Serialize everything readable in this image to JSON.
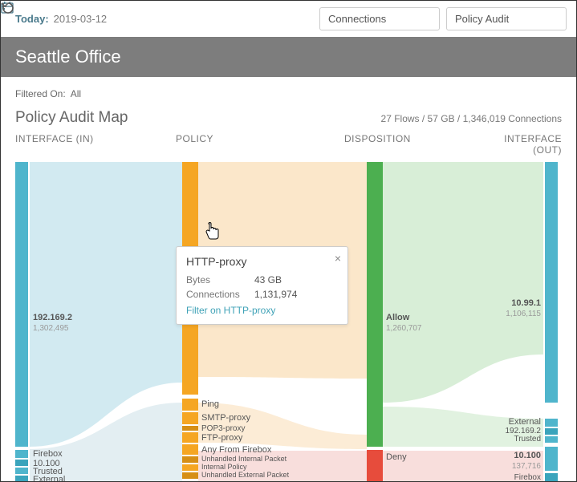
{
  "topbar": {
    "date_label": "Today:",
    "date_value": "2019-03-12",
    "dropdown_data": "Connections",
    "dropdown_view": "Policy Audit"
  },
  "page_title": "Seattle Office",
  "filter": {
    "label": "Filtered On:",
    "value": "All"
  },
  "map": {
    "title": "Policy Audit Map",
    "stats": "27 Flows / 57 GB / 1,346,019 Connections"
  },
  "columns": [
    "INTERFACE (IN)",
    "POLICY",
    "DISPOSITION",
    "INTERFACE (OUT)"
  ],
  "tooltip": {
    "title": "HTTP-proxy",
    "bytes_label": "Bytes",
    "bytes_value": "43 GB",
    "conn_label": "Connections",
    "conn_value": "1,131,974",
    "filter_link": "Filter on HTTP-proxy"
  },
  "labels": {
    "in_main": "192.169.2",
    "in_main_v": "1,302,495",
    "in_firebox": "Firebox",
    "in_10100": "10.100",
    "in_trusted": "Trusted",
    "in_external": "External",
    "pol_ping": "Ping",
    "pol_smtp": "SMTP-proxy",
    "pol_pop3": "POP3-proxy",
    "pol_ftp": "FTP-proxy",
    "pol_any": "Any From Firebox",
    "pol_unh_int": "Unhandled Internal Packet",
    "pol_intpol": "Internal Policy",
    "pol_unh_ext": "Unhandled External Packet",
    "disp_allow": "Allow",
    "disp_allow_v": "1,260,707",
    "disp_deny": "Deny",
    "out_1099": "10.99.1",
    "out_1099_v": "1,106,115",
    "out_external": "External",
    "out_19216": "192.169.2",
    "out_trusted": "Trusted",
    "out_10100": "10.100",
    "out_10100_v": "137,716",
    "out_firebox": "Firebox"
  },
  "colors": {
    "interface_in": "#4fb5cc",
    "policy": "#f5a623",
    "disposition_allow": "#4caf50",
    "disposition_deny": "#e74c3c",
    "interface_out": "#4fb5cc",
    "flow_blue": "#cde8ef",
    "flow_orange": "#fbe4c4",
    "flow_green": "#d4ecd3",
    "flow_pink": "#f6d6d3"
  },
  "chart_data": {
    "type": "sankey",
    "title": "Policy Audit Map",
    "totals": {
      "flows": 27,
      "bytes_gb": 57,
      "connections": 1346019
    },
    "stages": [
      "INTERFACE (IN)",
      "POLICY",
      "DISPOSITION",
      "INTERFACE (OUT)"
    ],
    "nodes": {
      "interface_in": [
        {
          "name": "192.169.2",
          "connections": 1302495
        },
        {
          "name": "Firebox"
        },
        {
          "name": "10.100"
        },
        {
          "name": "Trusted"
        },
        {
          "name": "External"
        }
      ],
      "policy": [
        {
          "name": "HTTP-proxy",
          "connections": 1131974,
          "bytes_gb": 43
        },
        {
          "name": "Ping"
        },
        {
          "name": "SMTP-proxy"
        },
        {
          "name": "POP3-proxy"
        },
        {
          "name": "FTP-proxy"
        },
        {
          "name": "Any From Firebox"
        },
        {
          "name": "Unhandled Internal Packet"
        },
        {
          "name": "Internal Policy"
        },
        {
          "name": "Unhandled External Packet"
        }
      ],
      "disposition": [
        {
          "name": "Allow",
          "connections": 1260707
        },
        {
          "name": "Deny"
        }
      ],
      "interface_out": [
        {
          "name": "10.99.1",
          "connections": 1106115
        },
        {
          "name": "External"
        },
        {
          "name": "192.169.2"
        },
        {
          "name": "Trusted"
        },
        {
          "name": "10.100",
          "connections": 137716
        },
        {
          "name": "Firebox"
        }
      ]
    }
  }
}
